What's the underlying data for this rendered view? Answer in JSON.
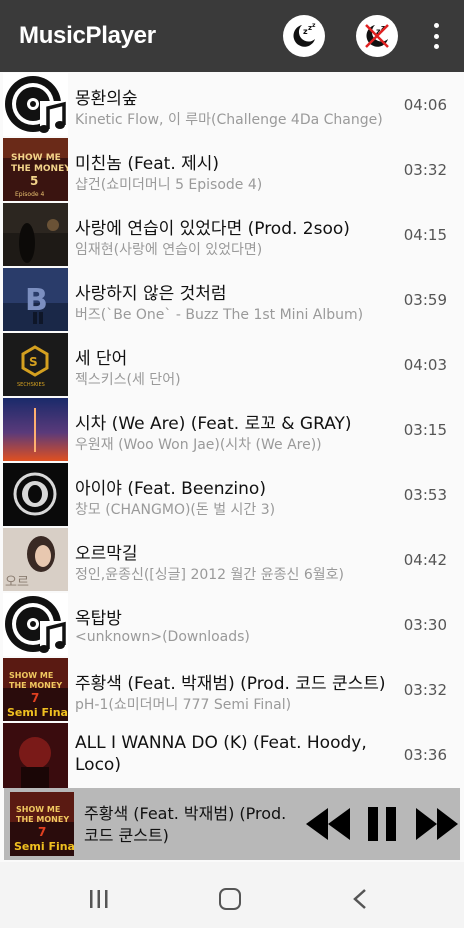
{
  "app_bar": {
    "title": "MusicPlayer",
    "icons": [
      "sleep-timer-icon",
      "sleep-timer-off-icon",
      "more-vert-icon"
    ]
  },
  "songs": [
    {
      "title": "몽환의숲",
      "subtitle": "Kinetic Flow, 이 루마(Challenge 4Da Change)",
      "duration": "04:06",
      "art": "default-disc-icon"
    },
    {
      "title": "미친놈 (Feat. 제시)",
      "subtitle": "샵건(쇼미더머니 5 Episode 4)",
      "duration": "03:32",
      "art": "album-art"
    },
    {
      "title": "사랑에 연습이 있었다면 (Prod. 2soo)",
      "subtitle": "임재현(사랑에 연습이 있었다면)",
      "duration": "04:15",
      "art": "album-art"
    },
    {
      "title": "사랑하지 않은 것처럼",
      "subtitle": "버즈(`Be One` - Buzz The 1st Mini Album)",
      "duration": "03:59",
      "art": "album-art"
    },
    {
      "title": "세 단어",
      "subtitle": "젝스키스(세 단어)",
      "duration": "04:03",
      "art": "album-art"
    },
    {
      "title": "시차 (We Are) (Feat. 로꼬 & GRAY)",
      "subtitle": "우원재 (Woo Won Jae)(시차 (We Are))",
      "duration": "03:15",
      "art": "album-art"
    },
    {
      "title": "아이야 (Feat. Beenzino)",
      "subtitle": "창모 (CHANGMO)(돈 벌 시간 3)",
      "duration": "03:53",
      "art": "album-art"
    },
    {
      "title": "오르막길",
      "subtitle": "정인,윤종신([싱글] 2012 월간 윤종신 6월호)",
      "duration": "04:42",
      "art": "album-art"
    },
    {
      "title": "옥탑방",
      "subtitle": "<unknown>(Downloads)",
      "duration": "03:30",
      "art": "default-disc-icon"
    },
    {
      "title": "주황색 (Feat. 박재범) (Prod. 코드 쿤스트)",
      "subtitle": "pH-1(쇼미더머니 777 Semi Final)",
      "duration": "03:32",
      "art": "album-art"
    },
    {
      "title": "ALL I WANNA DO (K) (Feat. Hoody, Loco)",
      "subtitle": "",
      "duration": "03:36",
      "art": "album-art"
    }
  ],
  "now_playing": {
    "title": "주황색 (Feat. 박재범) (Prod. 코드 쿤스트)",
    "controls": [
      "previous-icon",
      "pause-icon",
      "next-icon"
    ]
  },
  "system_nav": [
    "recent-apps-icon",
    "home-icon",
    "back-icon"
  ],
  "colors": {
    "app_bar": "#3a3a3a",
    "list_bg": "#fafafa",
    "now_bar": "#b8b8b8",
    "subtitle_text": "#9a9a9a"
  }
}
